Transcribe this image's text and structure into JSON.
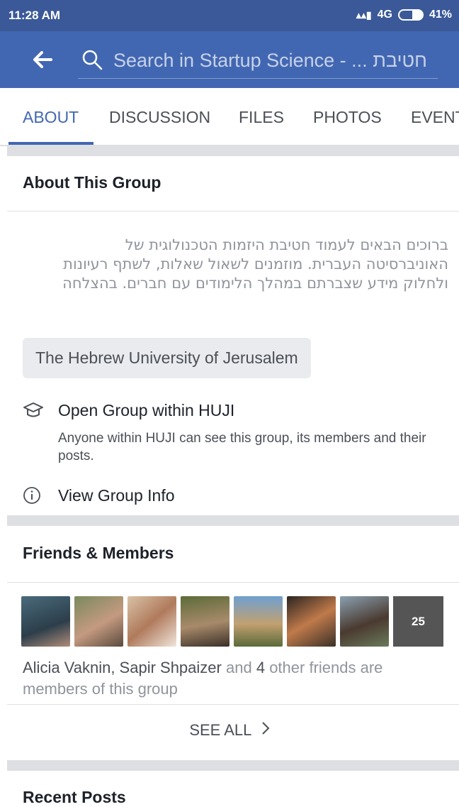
{
  "status_bar": {
    "time": "11:28 AM",
    "network": "4G",
    "battery": "41%"
  },
  "header": {
    "search_placeholder": "Search in Startup Science - ... חטיבת"
  },
  "tabs": [
    {
      "label": "ABOUT",
      "active": true
    },
    {
      "label": "DISCUSSION",
      "active": false
    },
    {
      "label": "FILES",
      "active": false
    },
    {
      "label": "PHOTOS",
      "active": false
    },
    {
      "label": "EVENTS",
      "active": false
    }
  ],
  "about": {
    "title": "About This Group",
    "description": "ברוכים הבאים לעמוד חטיבת היזמות הטכנולוגית של האוניברסיטה העברית. מוזמנים לשאול שאלות, לשתף רעיונות ולחלוק מידע שצברתם במהלך הלימודים עם חברים. בהצלחה",
    "tag": "The Hebrew University of Jerusalem",
    "privacy_title": "Open Group within HUJI",
    "privacy_sub": "Anyone within HUJI can see this group, its members and their posts.",
    "view_info": "View Group Info"
  },
  "members": {
    "title": "Friends & Members",
    "more_count": "25",
    "friend_names": "Alicia Vaknin, Sapir Shpaizer",
    "and_text": "and",
    "friend_count": "4",
    "tail_text": "other friends are members of this group",
    "see_all": "SEE ALL"
  },
  "recent": {
    "title": "Recent Posts"
  },
  "colors": {
    "brand": "#4267b2",
    "status_bar": "#3b5998",
    "separator": "#dddfe2"
  }
}
